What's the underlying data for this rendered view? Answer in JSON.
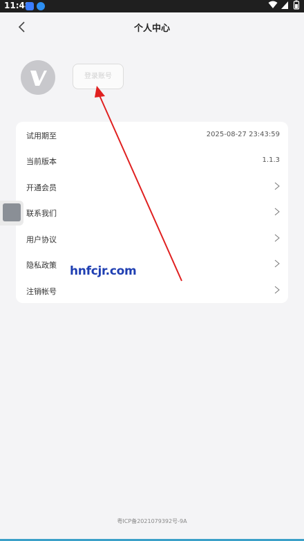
{
  "status_bar": {
    "time": "11:48"
  },
  "header": {
    "title": "个人中心"
  },
  "profile": {
    "login_label": "登录账号"
  },
  "settings": {
    "rows": [
      {
        "label": "试用期至",
        "value": "2025-08-27 23:43:59"
      },
      {
        "label": "当前版本",
        "value": "1.1.3"
      },
      {
        "label": "开通会员",
        "value": ">"
      },
      {
        "label": "联系我们",
        "value": ">"
      },
      {
        "label": "用户协议",
        "value": ">"
      },
      {
        "label": "隐私政策",
        "value": ">"
      },
      {
        "label": "注销帐号",
        "value": ">"
      }
    ]
  },
  "watermark": "hnfcjr.com",
  "footer": {
    "icp": "粤ICP备2021079392号-9A"
  },
  "colors": {
    "background": "#f4f4f6",
    "annotation": "#e02020",
    "watermark": "#1f3fb2"
  },
  "icons": [
    "back-icon",
    "app-logo-icon",
    "chevron-right-icon",
    "wifi-icon",
    "battery-icon"
  ]
}
